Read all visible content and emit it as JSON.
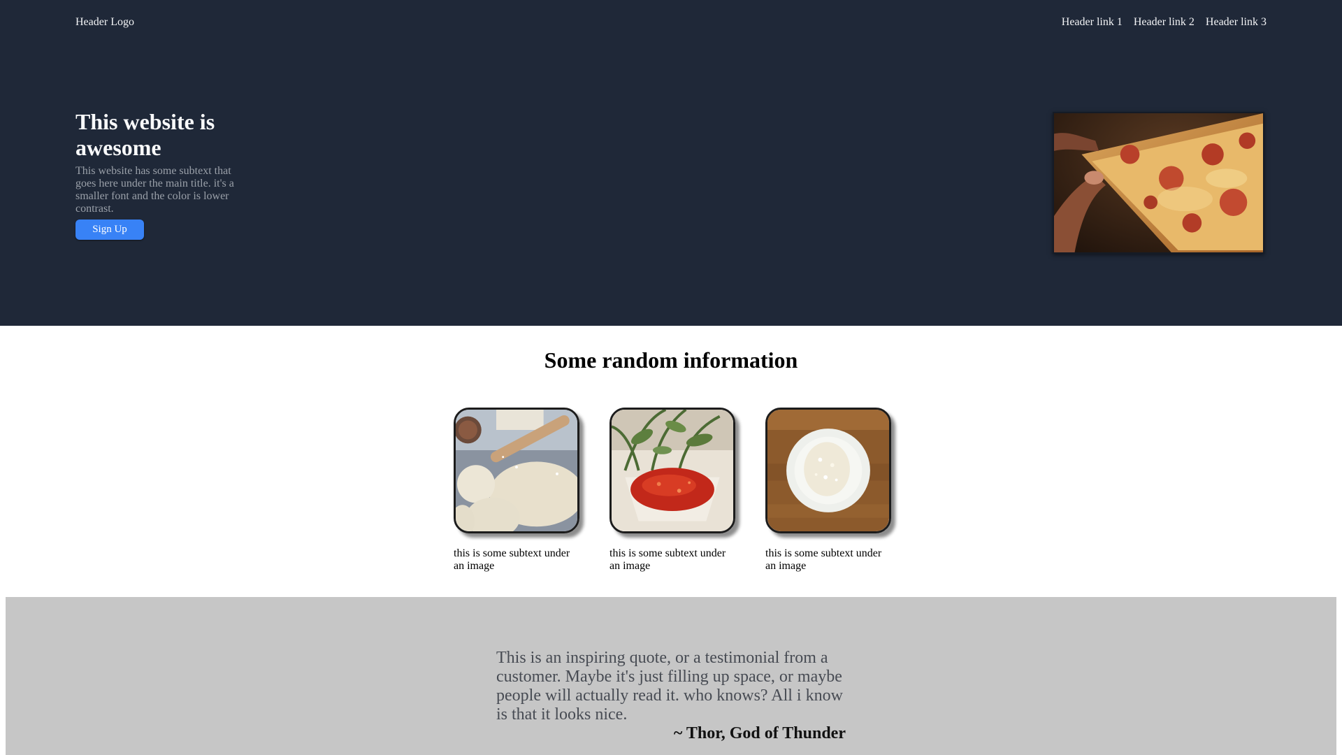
{
  "header": {
    "logo": "Header Logo",
    "links": [
      "Header link 1",
      "Header link 2",
      "Header link 3"
    ]
  },
  "hero": {
    "title": "This website is awesome",
    "subtext": "This website has some subtext that goes here under the main title. it's a smaller font and the color is lower contrast.",
    "signup_label": "Sign Up",
    "image_subject": "pizza-slice"
  },
  "info": {
    "title": "Some random information",
    "cards": [
      {
        "image_subject": "dough-and-rolling-pin",
        "caption": "this is some subtext under an image"
      },
      {
        "image_subject": "tomato-sauce-with-herbs",
        "caption": "this is some subtext under an image"
      },
      {
        "image_subject": "grated-cheese-plate",
        "caption": "this is some subtext under an image"
      }
    ]
  },
  "quote": {
    "text": "This is an inspiring quote, or a testimonial from a customer. Maybe it's just filling up space, or maybe people will actually read it. who knows? All i know is that it looks nice.",
    "author": "~ Thor, God of Thunder"
  },
  "colors": {
    "hero_bg": "#1f2838",
    "button": "#3882f6",
    "quote_bg": "#c6c6c6"
  }
}
